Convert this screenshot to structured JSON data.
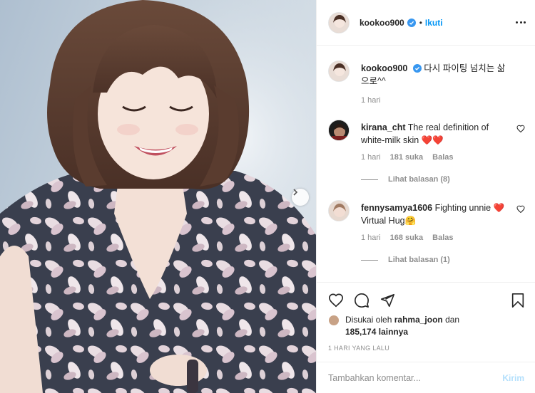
{
  "post": {
    "author": "kookoo900",
    "verified": true,
    "separator": "•",
    "follow_label": "Ikuti",
    "caption": "다시 파이팅 넘치는 삶으로^^",
    "caption_time": "1 hari"
  },
  "comments": [
    {
      "username": "kirana_cht",
      "text": "The real definition of white-milk skin ❤️❤️",
      "time": "1 hari",
      "likes": "181 suka",
      "reply_label": "Balas",
      "view_replies": "Lihat balasan (8)"
    },
    {
      "username": "fennysamya1606",
      "text": "Fighting unnie ❤️ Virtual Hug🤗",
      "time": "1 hari",
      "likes": "168 suka",
      "reply_label": "Balas",
      "view_replies": "Lihat balasan (1)"
    }
  ],
  "likes": {
    "prefix": "Disukai oleh",
    "user": "rahma_joon",
    "joiner": "dan",
    "count": "185,174",
    "suffix": "lainnya"
  },
  "time_ago": "1 HARI YANG LALU",
  "add_comment": {
    "placeholder": "Tambahkan komentar...",
    "send_label": "Kirim"
  },
  "colors": {
    "accent": "#0095f6",
    "send_disabled": "#b2dffc",
    "heart": "#ed4956",
    "muted": "#8e8e8e"
  },
  "icons": [
    "next-arrow-icon",
    "verified-badge-icon",
    "more-options-icon",
    "heart-outline-icon",
    "comment-icon",
    "share-icon",
    "bookmark-icon"
  ]
}
